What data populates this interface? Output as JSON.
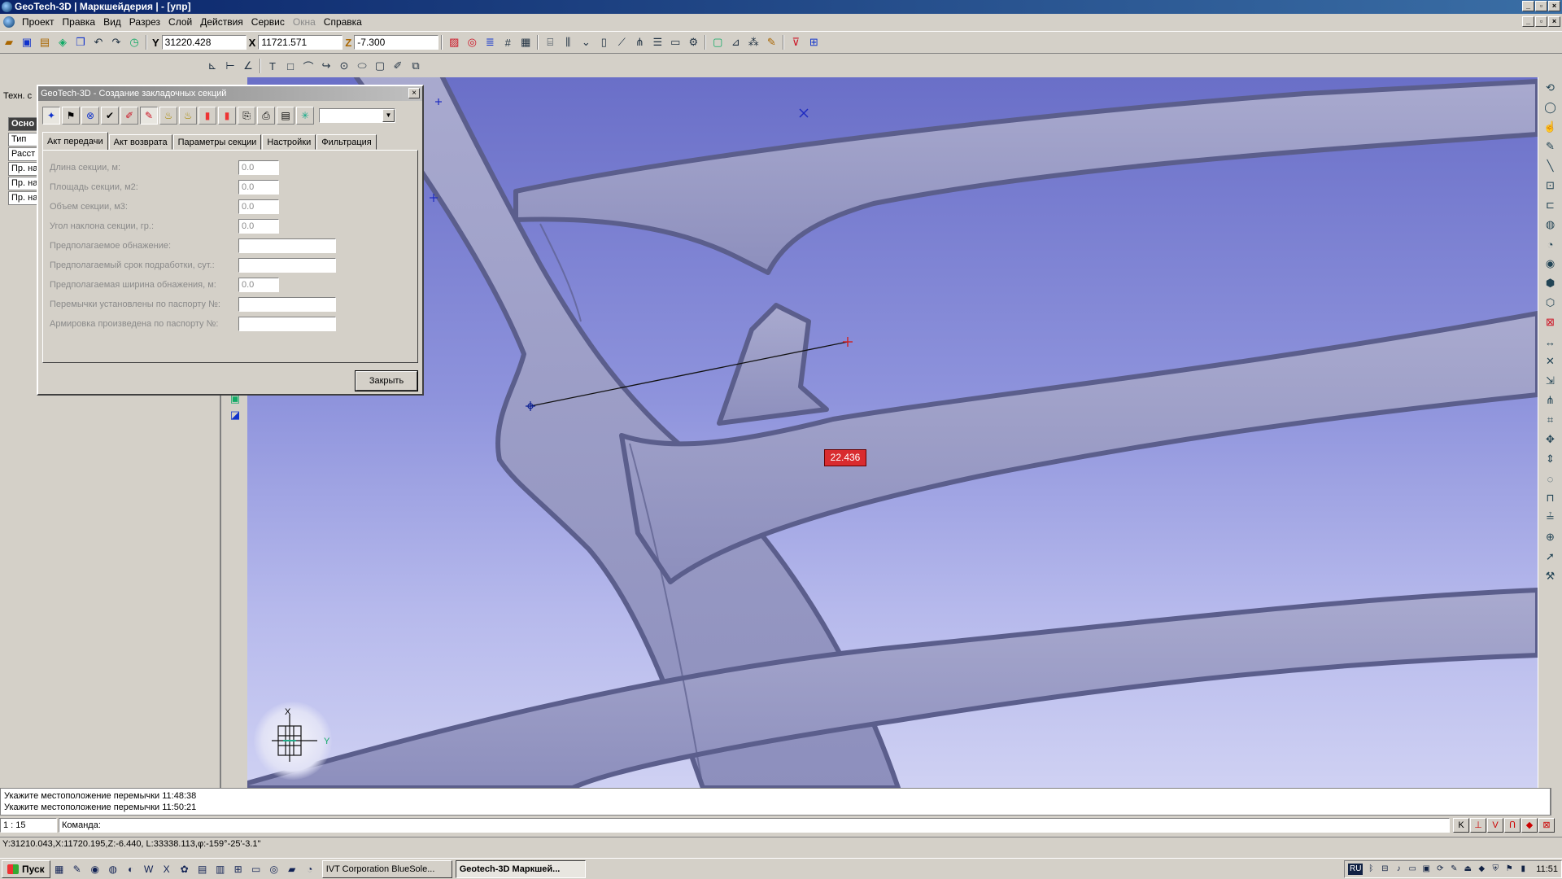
{
  "window": {
    "title": "GeoTech-3D | Маркшейдерия | - [упр]"
  },
  "menu": {
    "items": [
      "Проект",
      "Правка",
      "Вид",
      "Разрез",
      "Слой",
      "Действия",
      "Сервис",
      "Окна",
      "Справка"
    ],
    "disabled": [
      "Окна"
    ]
  },
  "coords": {
    "y_label": "Y",
    "y_value": "31220.428",
    "x_label": "X",
    "x_value": "11721.571",
    "z_label": "Z",
    "z_value": "-7.300"
  },
  "left_panel": {
    "tab": "Техн. с",
    "header": "Осно",
    "rows": [
      "Тип",
      "Расст",
      "Пр. на",
      "Пр. на",
      "Пр. на"
    ]
  },
  "dialog": {
    "title": "GeoTech-3D - Создание закладочных секций",
    "close_glyph": "×",
    "tabs": [
      "Акт передачи",
      "Акт возврата",
      "Параметры секции",
      "Настройки",
      "Фильтрация"
    ],
    "active_tab": "Акт передачи",
    "fields": [
      {
        "label": "Длина секции, м:",
        "value": "0.0",
        "wide": false
      },
      {
        "label": "Площадь секции, м2:",
        "value": "0.0",
        "wide": false
      },
      {
        "label": "Объем секции, м3:",
        "value": "0.0",
        "wide": false
      },
      {
        "label": "Угол наклона секции, гр.:",
        "value": "0.0",
        "wide": false
      },
      {
        "label": "Предполагаемое обнажение:",
        "value": "",
        "wide": true
      },
      {
        "label": "Предполагаемый срок подработки, сут.:",
        "value": "",
        "wide": true
      },
      {
        "label": "Предполагаемая ширина обнажения, м:",
        "value": "0.0",
        "wide": false
      },
      {
        "label": "Перемычки установлены по паспорту №:",
        "value": "",
        "wide": true
      },
      {
        "label": "Армировка произведена по паспорту №:",
        "value": "",
        "wide": true
      }
    ],
    "close_button": "Закрыть"
  },
  "viewport": {
    "measure_value": "22.436",
    "axis_x": "X",
    "axis_y": "Y"
  },
  "messages": [
    "Укажите местоположение перемычки 11:48:38",
    "Укажите местоположение перемычки 11:50:21"
  ],
  "command": {
    "scale": "1 : 15",
    "label": "Команда:"
  },
  "snap_buttons": [
    "K",
    "⊥",
    "V",
    "Ո",
    "◆",
    "⊠"
  ],
  "status": {
    "text": "Y:31210.043,X:11720.195,Z:-6.440, L:33338.113,φ:-159°-25'-3.1\""
  },
  "taskbar": {
    "start": "Пуск",
    "tasks": [
      "IVT Corporation BlueSole...",
      "Geotech-3D Маркшей..."
    ],
    "active_task": 1,
    "lang": "RU",
    "clock": "11:51"
  },
  "colors": {
    "viewport_top": "#6a6fc8",
    "measure_bg": "#d92b2f",
    "title_bg": "#0a246a"
  }
}
